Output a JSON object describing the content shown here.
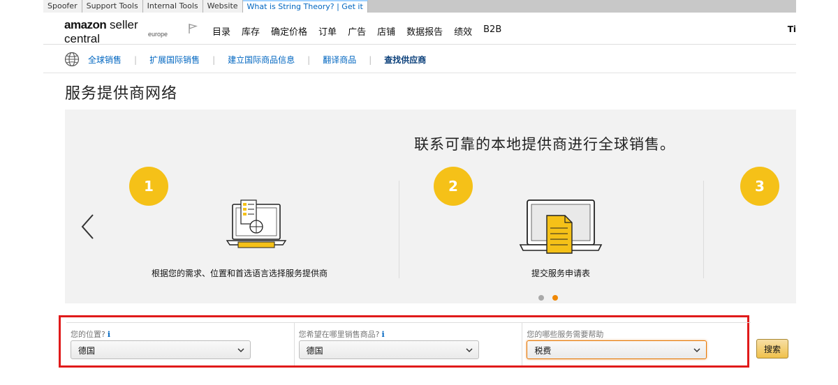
{
  "tabstrip": {
    "tabs": [
      {
        "label": "Spoofer"
      },
      {
        "label": "Support Tools"
      },
      {
        "label": "Internal Tools"
      },
      {
        "label": "Website"
      },
      {
        "label": "What is String Theory? | Get it"
      }
    ]
  },
  "header": {
    "brand_bold": "amazon",
    "brand_rest": " seller central",
    "region": "europe",
    "nav": [
      "目录",
      "库存",
      "确定价格",
      "订单",
      "广告",
      "店铺",
      "数据报告",
      "绩效",
      "B2B"
    ],
    "user": "Ti"
  },
  "subnav": {
    "links": [
      "全球销售",
      "扩展国际销售",
      "建立国际商品信息",
      "翻译商品",
      "查找供应商"
    ]
  },
  "page": {
    "title": "服务提供商网络"
  },
  "carousel": {
    "headline": "联系可靠的本地提供商进行全球销售。",
    "steps": [
      {
        "number": "1",
        "caption": "根据您的需求、位置和首选语言选择服务提供商"
      },
      {
        "number": "2",
        "caption": "提交服务申请表"
      },
      {
        "number": "3",
        "caption": ""
      }
    ],
    "active_dot": 2,
    "accent_color": "#f5c118"
  },
  "filters": {
    "location": {
      "label": "您的位置?",
      "info": "i",
      "value": "德国"
    },
    "sell_where": {
      "label": "您希望在哪里销售商品?",
      "info": "i",
      "value": "德国"
    },
    "services": {
      "label": "您的哪些服务需要帮助",
      "value": "税费"
    },
    "search_label": "搜索"
  }
}
